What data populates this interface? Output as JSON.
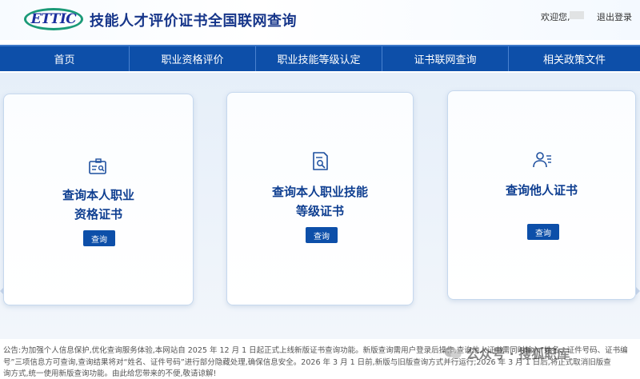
{
  "header": {
    "logo_text": "ETTIC",
    "title": "技能人才评价证书全国联网查询",
    "welcome": "欢迎您,",
    "logout": "退出登录"
  },
  "nav": {
    "items": [
      {
        "label": "首页"
      },
      {
        "label": "职业资格评价"
      },
      {
        "label": "职业技能等级认定"
      },
      {
        "label": "证书联网查询"
      },
      {
        "label": "相关政策文件"
      }
    ]
  },
  "cards": [
    {
      "title_line1": "查询本人职业",
      "title_line2": "资格证书",
      "icon": "certificate-search-icon",
      "button": "查询"
    },
    {
      "title_line1": "查询本人职业技能",
      "title_line2": "等级证书",
      "icon": "document-search-icon",
      "button": "查询"
    },
    {
      "title_line1": "查询他人证书",
      "title_line2": "",
      "icon": "person-id-icon",
      "button": "查询"
    }
  ],
  "notice": {
    "line1": "公告:为加强个人信息保护,优化查询服务体验,本网站自 2025 年 12 月 1 日起正式上线新版证书查询功能。新版查询需用户登录后操作,查询他人证书需同时输入“姓名、证件号码、证书编",
    "line2": "号”三项信息方可查询,查询结果将对“姓名、证件号码”进行部分隐藏处理,确保信息安全。2026 年 3 月 1 日前,新版与旧版查询方式并行运行;2026 年 3 月 1 日后,将正式取消旧版查",
    "line3": "询方式,统一使用新版查询功能。由此给您带来的不便,敬请谅解!"
  },
  "watermark": {
    "text": "公众号 · 搜狐职库"
  },
  "colors": {
    "nav_bg": "#0d4fa9",
    "title": "#17368a",
    "card_title": "#0f3f91",
    "logo_ring": "#1b9a78"
  }
}
